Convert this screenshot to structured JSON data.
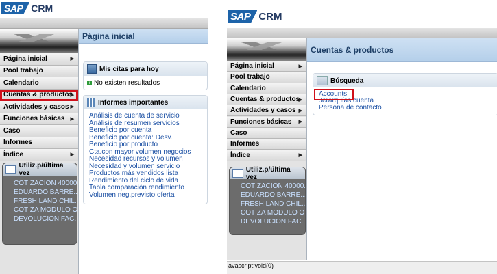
{
  "brand": {
    "sap": "SAP",
    "crm": "CRM",
    "color": "#1d63a9"
  },
  "left_screen": {
    "page_title": "Página inicial",
    "nav": [
      {
        "label": "Página inicial",
        "arrow": true
      },
      {
        "label": "Pool trabajo",
        "arrow": false
      },
      {
        "label": "Calendario",
        "arrow": false
      },
      {
        "label": "Cuentas & productos",
        "arrow": true,
        "highlighted": true
      },
      {
        "label": "Actividades y casos",
        "arrow": true
      },
      {
        "label": "Funciones básicas",
        "arrow": true
      },
      {
        "label": "Caso",
        "arrow": false
      },
      {
        "label": "Informes",
        "arrow": false
      },
      {
        "label": "Índice",
        "arrow": true
      }
    ],
    "recent": {
      "title": "Utiliz.p/última vez",
      "items": [
        "COTIZACION 40000...",
        "EDUARDO BARRE...",
        "FRESH LAND CHIL...",
        "COTIZA MODULO O...",
        "DEVOLUCION FAC..."
      ]
    },
    "appointments": {
      "title": "Mis citas para hoy",
      "empty": "No existen resultados"
    },
    "reports": {
      "title": "Informes importantes",
      "links": [
        "Análisis de cuenta de servicio",
        "Análisis de resumen servicios",
        "Beneficio por cuenta",
        "Beneficio por cuenta: Desv.",
        "Beneficio por producto",
        "Cta.con mayor volumen negocios",
        "Necesidad recursos y volumen",
        "Necesidad y volumen servicio",
        "Productos más vendidos lista",
        "Rendimiento del ciclo de vida",
        "Tabla comparación rendimiento",
        "Volumen neg.previsto oferta"
      ]
    }
  },
  "right_screen": {
    "page_title": "Cuentas & productos",
    "nav": [
      {
        "label": "Página inicial",
        "arrow": true
      },
      {
        "label": "Pool trabajo",
        "arrow": false
      },
      {
        "label": "Calendario",
        "arrow": false
      },
      {
        "label": "Cuentas & productos",
        "arrow": true
      },
      {
        "label": "Actividades y casos",
        "arrow": true
      },
      {
        "label": "Funciones básicas",
        "arrow": true
      },
      {
        "label": "Caso",
        "arrow": false
      },
      {
        "label": "Informes",
        "arrow": false
      },
      {
        "label": "Índice",
        "arrow": true
      }
    ],
    "recent": {
      "title": "Utiliz.p/última vez",
      "items": [
        "COTIZACION 40000...",
        "EDUARDO BARRE...",
        "FRESH LAND CHIL...",
        "COTIZA MODULO O...",
        "DEVOLUCION FAC..."
      ]
    },
    "search": {
      "title": "Búsqueda",
      "links": [
        "Accounts",
        "Jerarquías cuenta",
        "Persona de contacto"
      ],
      "highlighted_link": "Accounts"
    },
    "status": "avascript:void(0)"
  },
  "colors": {
    "highlight": "#d0101a",
    "link": "#1a4fa3",
    "title": "#1e3f66"
  }
}
